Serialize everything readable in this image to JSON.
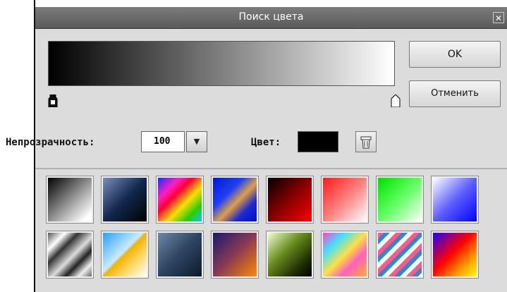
{
  "dialog": {
    "title": "Поиск цвета",
    "ok_label": "OK",
    "cancel_label": "Отменить",
    "opacity_label": "Непрозрачность:",
    "opacity_value": "100",
    "color_label": "Цвет:",
    "current_color": "#000000"
  },
  "gradient": {
    "start_color": "#000000",
    "end_color": "#ffffff"
  },
  "presets": [
    {
      "name": "black-white"
    },
    {
      "name": "navy-black"
    },
    {
      "name": "rainbow"
    },
    {
      "name": "blue-gold"
    },
    {
      "name": "red-black"
    },
    {
      "name": "red-white"
    },
    {
      "name": "green-white"
    },
    {
      "name": "blue-white"
    },
    {
      "name": "silver-stripes"
    },
    {
      "name": "sky-gold"
    },
    {
      "name": "steel-blue"
    },
    {
      "name": "purple-orange"
    },
    {
      "name": "olive-green"
    },
    {
      "name": "pastel-rainbow"
    },
    {
      "name": "candy-stripes"
    },
    {
      "name": "blue-red-yellow"
    }
  ]
}
